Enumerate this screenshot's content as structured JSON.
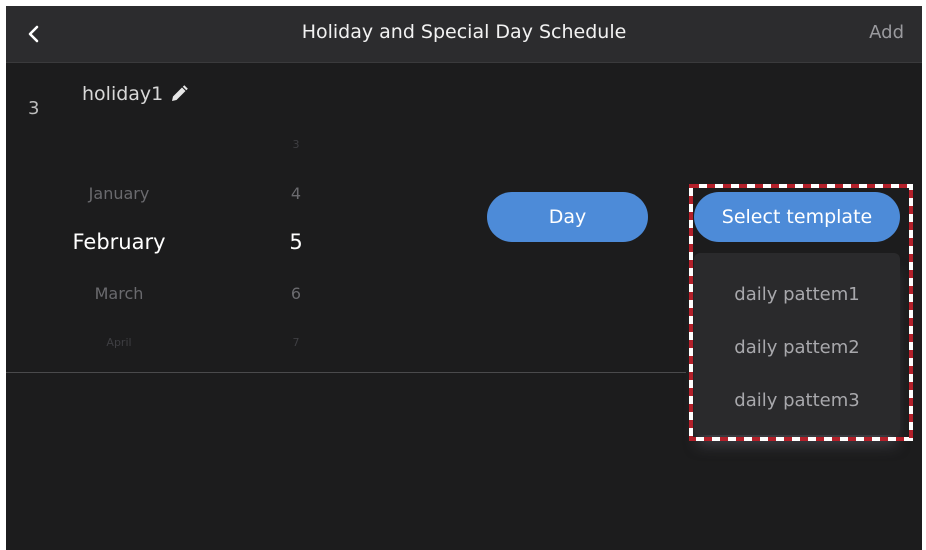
{
  "header": {
    "title": "Holiday and Special Day Schedule",
    "add_label": "Add",
    "back_icon": "chevron-left-icon"
  },
  "holiday": {
    "index": "3",
    "name": "holiday1",
    "edit_icon": "pencil-icon"
  },
  "date_picker": {
    "months": [
      "January",
      "February",
      "March",
      "April"
    ],
    "selected_month": "February",
    "days": [
      "3",
      "4",
      "5",
      "6",
      "7"
    ],
    "selected_day": "5"
  },
  "buttons": {
    "day_label": "Day",
    "select_template_label": "Select template"
  },
  "template_dropdown": {
    "options": [
      "daily pattem1",
      "daily pattem2",
      "daily pattem3"
    ]
  },
  "colors": {
    "accent": "#4d8bd8",
    "background": "#1c1c1d",
    "header": "#2c2c2e",
    "highlight_red": "#b3202a"
  }
}
